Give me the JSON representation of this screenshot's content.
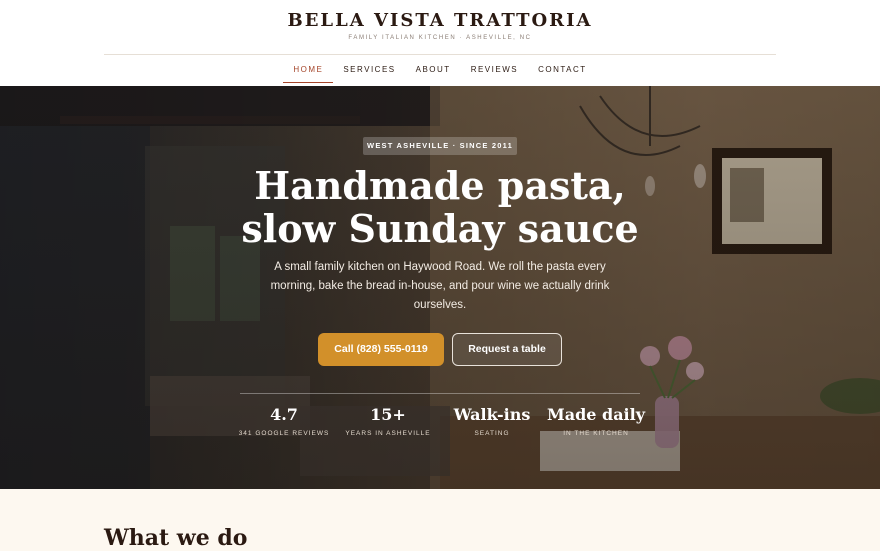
{
  "header": {
    "brand_name": "BELLA VISTA TRATTORIA",
    "tagline": "FAMILY ITALIAN KITCHEN · ASHEVILLE, NC"
  },
  "nav": {
    "items": [
      {
        "label": "HOME",
        "active": true
      },
      {
        "label": "SERVICES",
        "active": false
      },
      {
        "label": "ABOUT",
        "active": false
      },
      {
        "label": "REVIEWS",
        "active": false
      },
      {
        "label": "CONTACT",
        "active": false
      }
    ]
  },
  "hero": {
    "badge": "WEST ASHEVILLE · SINCE 2011",
    "title_line1": "Handmade pasta,",
    "title_line2": "slow Sunday sauce",
    "subtitle": "A small family kitchen on Haywood Road. We roll the pasta every morning, bake the bread in-house, and pour wine we actually drink ourselves.",
    "primary_cta": "Call (828) 555-0119",
    "secondary_cta": "Request a table",
    "stats": [
      {
        "value": "4.7",
        "label": "341 GOOGLE REVIEWS"
      },
      {
        "value": "15+",
        "label": "YEARS IN ASHEVILLE"
      },
      {
        "value": "Walk-ins",
        "label": "SEATING"
      },
      {
        "value": "Made daily",
        "label": "IN THE KITCHEN"
      }
    ]
  },
  "services": {
    "title": "What we do"
  },
  "colors": {
    "accent": "#d2902a",
    "nav_active": "#a5452a",
    "brand_text": "#2b1a12",
    "section_bg": "#fdf8f0"
  }
}
